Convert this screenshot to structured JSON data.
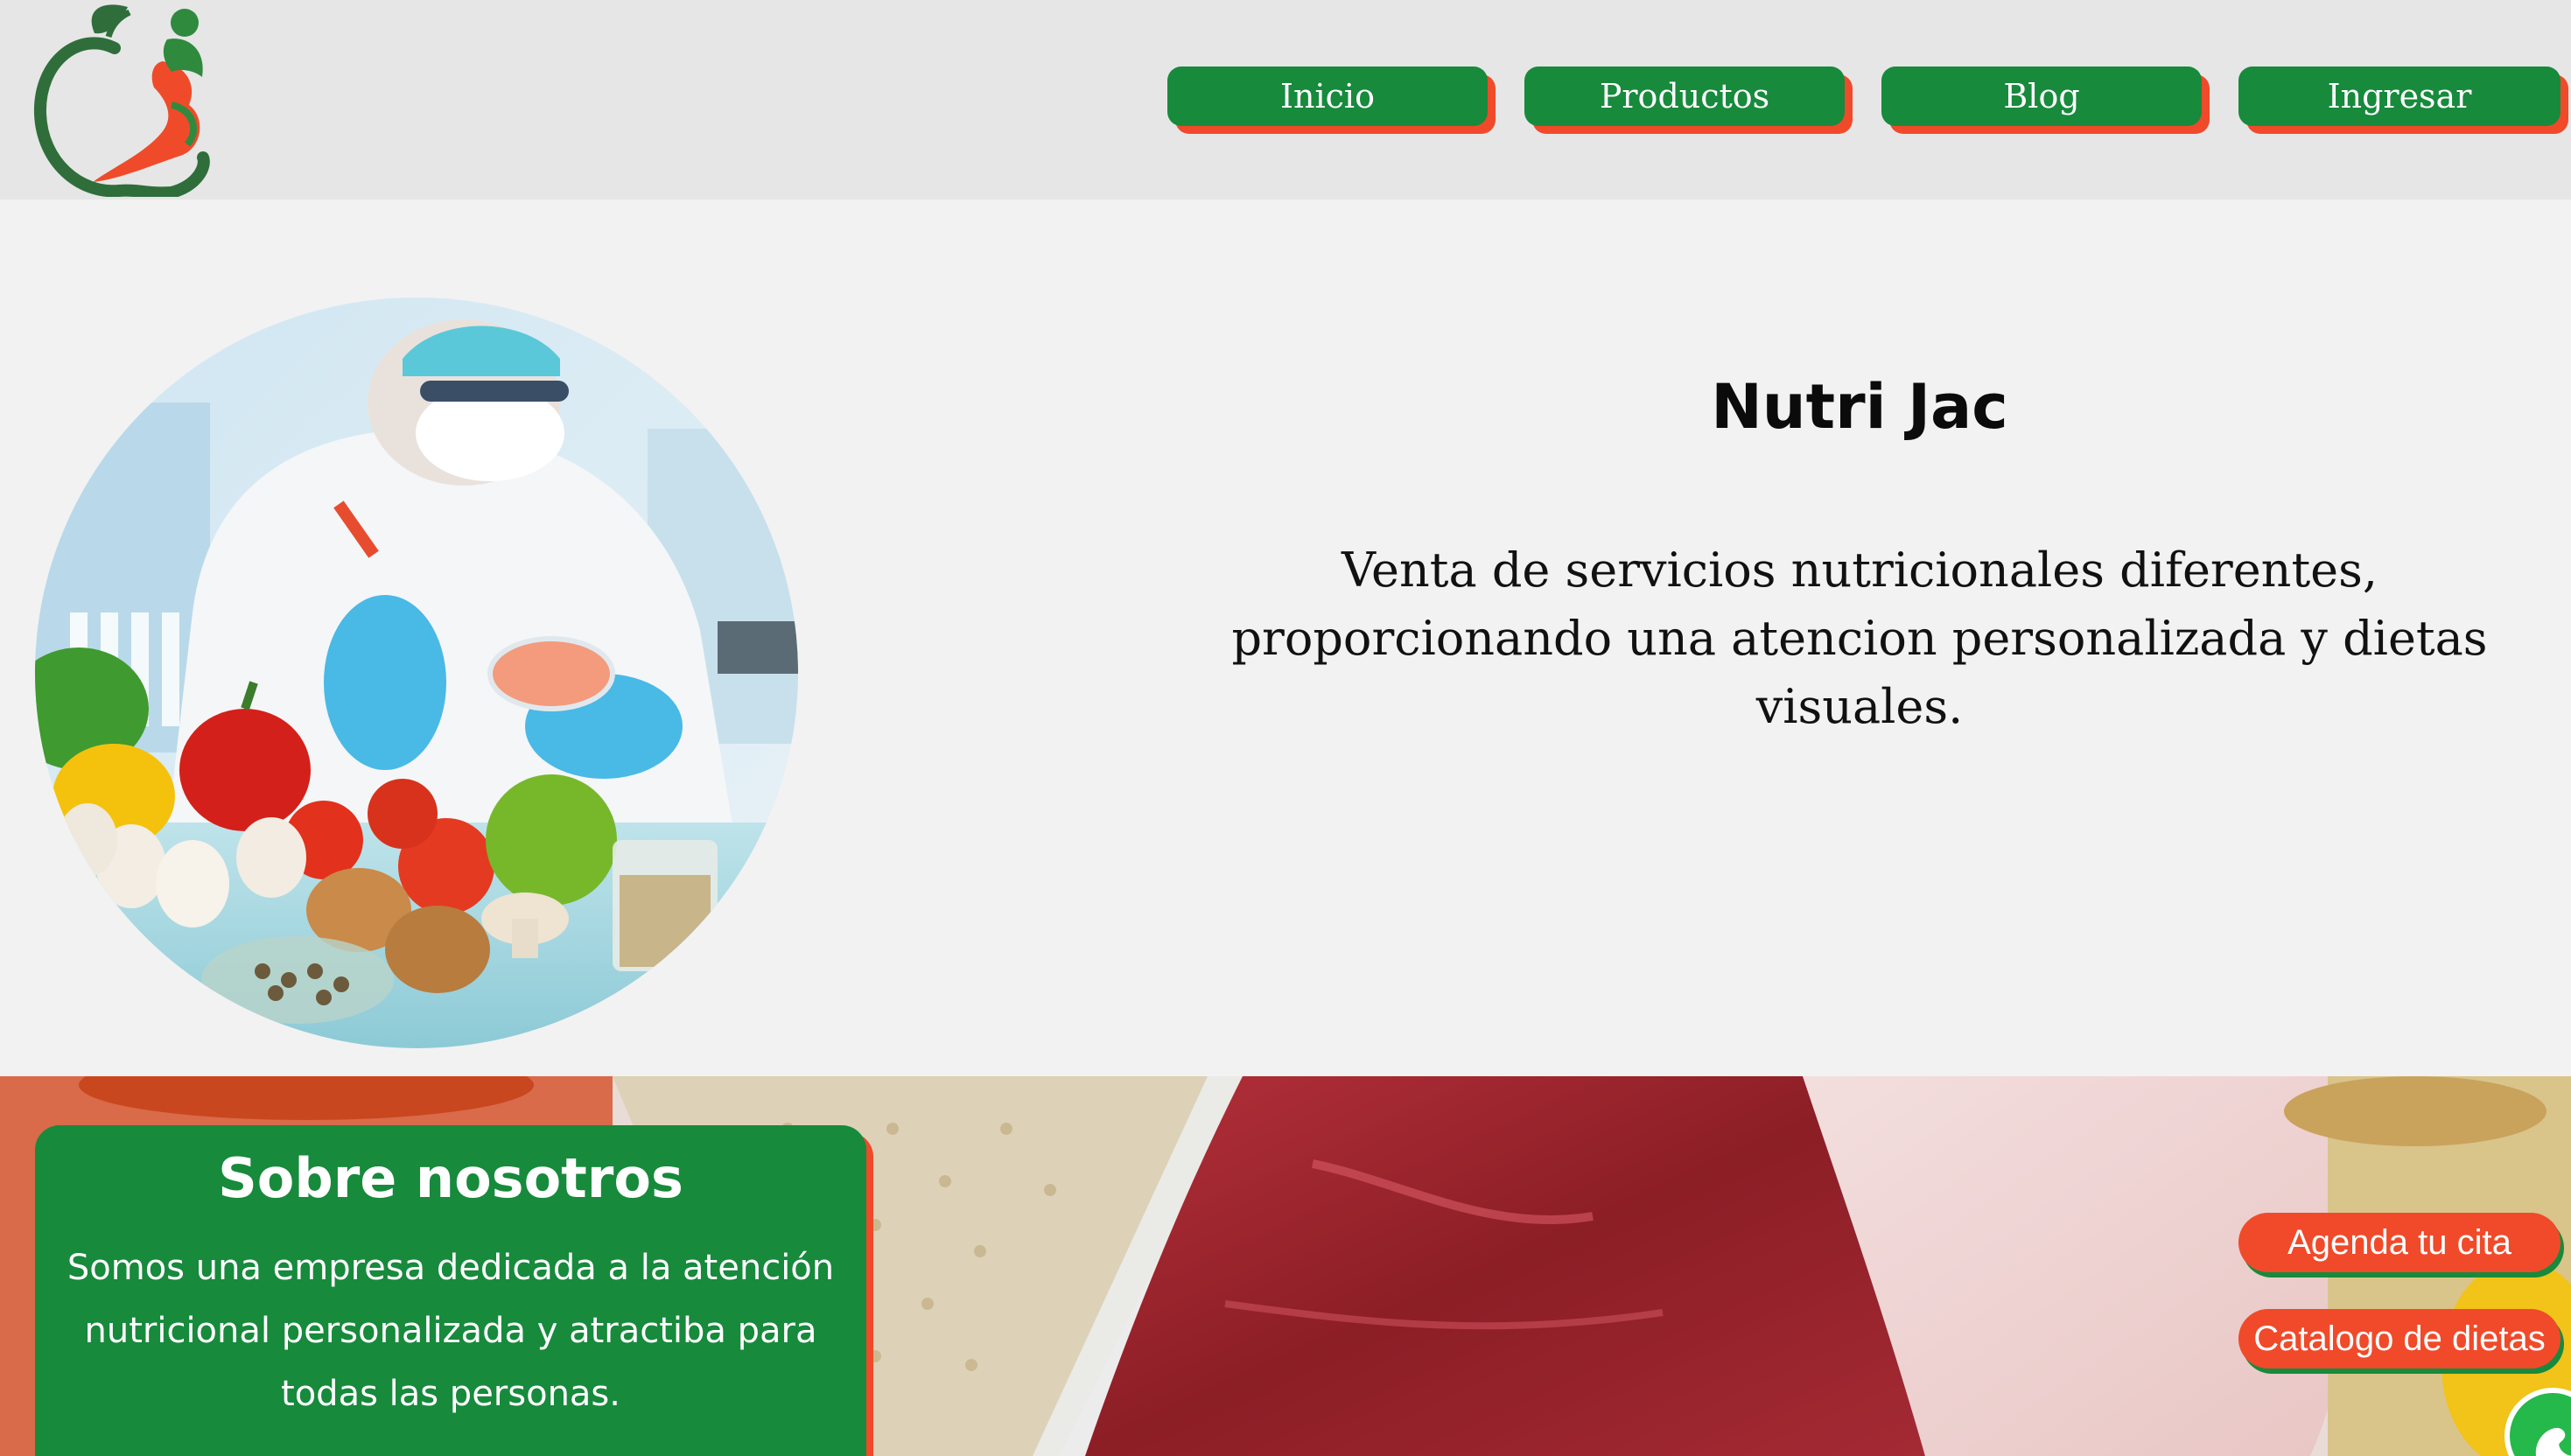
{
  "nav": {
    "items": [
      {
        "label": "Inicio"
      },
      {
        "label": "Productos"
      },
      {
        "label": "Blog"
      },
      {
        "label": "Ingresar"
      }
    ]
  },
  "hero": {
    "title": "Nutri Jac",
    "description": "Venta de servicios nutricionales diferentes, proporcionando una atencion personalizada y dietas visuales."
  },
  "about": {
    "title": "Sobre nosotros",
    "text": "Somos una empresa dedicada a la atención nutricional personalizada y atractiba para todas las personas."
  },
  "cta": {
    "appointment_label": "Agenda tu cita",
    "catalog_label": "Catalogo de dietas"
  },
  "icons": {
    "logo": "apple-logo-icon",
    "whatsapp": "whatsapp-icon"
  },
  "colors": {
    "brand_green": "#178a3c",
    "accent_orange": "#f04a2a",
    "header_bg": "#e6e6e6",
    "page_bg": "#f2f2f2"
  }
}
